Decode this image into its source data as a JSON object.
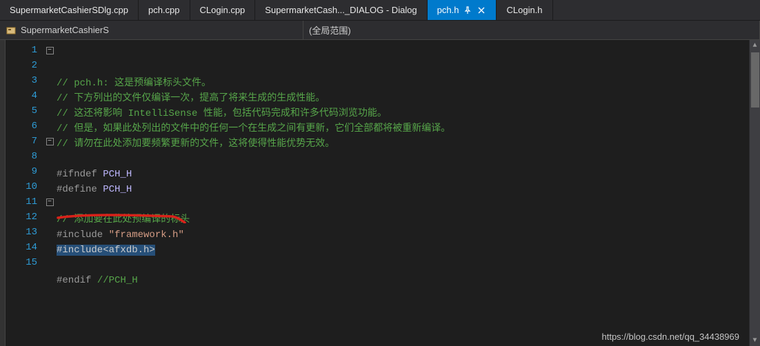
{
  "tabs": [
    {
      "label": "SupermarketCashierSDlg.cpp"
    },
    {
      "label": "pch.cpp"
    },
    {
      "label": "CLogin.cpp"
    },
    {
      "label": "SupermarketCash..._DIALOG - Dialog"
    },
    {
      "label": "pch.h",
      "active": true,
      "pin": true,
      "close": true
    },
    {
      "label": "CLogin.h"
    }
  ],
  "subbar": {
    "project": "SupermarketCashierS",
    "scope": "(全局范围)"
  },
  "code": {
    "lines": [
      {
        "n": "1",
        "fold": "open",
        "seg": [
          {
            "t": "// pch.h: 这是预编译标头文件。",
            "c": "c-comment"
          }
        ]
      },
      {
        "n": "2",
        "fold": "",
        "seg": [
          {
            "t": "// 下方列出的文件仅编译一次，提高了将来生成的生成性能。",
            "c": "c-comment"
          }
        ]
      },
      {
        "n": "3",
        "fold": "",
        "seg": [
          {
            "t": "// 这还将影响 IntelliSense 性能，包括代码完成和许多代码浏览功能。",
            "c": "c-comment"
          }
        ]
      },
      {
        "n": "4",
        "fold": "",
        "seg": [
          {
            "t": "// 但是，如果此处列出的文件中的任何一个在生成之间有更新，它们全部都将被重新编译。",
            "c": "c-comment"
          }
        ]
      },
      {
        "n": "5",
        "fold": "",
        "seg": [
          {
            "t": "// 请勿在此处添加要频繁更新的文件，这将使得性能优势无效。",
            "c": "c-comment"
          }
        ]
      },
      {
        "n": "6",
        "fold": "",
        "seg": []
      },
      {
        "n": "7",
        "fold": "open",
        "seg": [
          {
            "t": "#ifndef ",
            "c": "c-pre"
          },
          {
            "t": "PCH_H",
            "c": "c-macro"
          }
        ]
      },
      {
        "n": "8",
        "fold": "",
        "seg": [
          {
            "t": "#define ",
            "c": "c-pre"
          },
          {
            "t": "PCH_H",
            "c": "c-macro"
          }
        ]
      },
      {
        "n": "9",
        "fold": "",
        "seg": []
      },
      {
        "n": "10",
        "fold": "",
        "seg": [
          {
            "t": "// 添加要在此处预编译的标头",
            "c": "c-comment"
          }
        ]
      },
      {
        "n": "11",
        "fold": "open",
        "seg": [
          {
            "t": "#include ",
            "c": "c-pre"
          },
          {
            "t": "\"framework.h\"",
            "c": "c-str"
          }
        ]
      },
      {
        "n": "12",
        "fold": "",
        "seg": [
          {
            "t": "#include<afxdb.h>",
            "c": "sel"
          }
        ]
      },
      {
        "n": "13",
        "fold": "",
        "seg": []
      },
      {
        "n": "14",
        "fold": "",
        "seg": [
          {
            "t": "#endif ",
            "c": "c-pre"
          },
          {
            "t": "//PCH_H",
            "c": "c-comment"
          }
        ]
      },
      {
        "n": "15",
        "fold": "",
        "seg": []
      }
    ]
  },
  "watermark": "https://blog.csdn.net/qq_34438969",
  "colors": {
    "accent": "#007acc",
    "comment": "#57a64a",
    "string": "#d69d85",
    "macro": "#beb7ff",
    "lineno": "#2e9cd6",
    "selection": "#264f78",
    "underline": "#d9221a"
  }
}
